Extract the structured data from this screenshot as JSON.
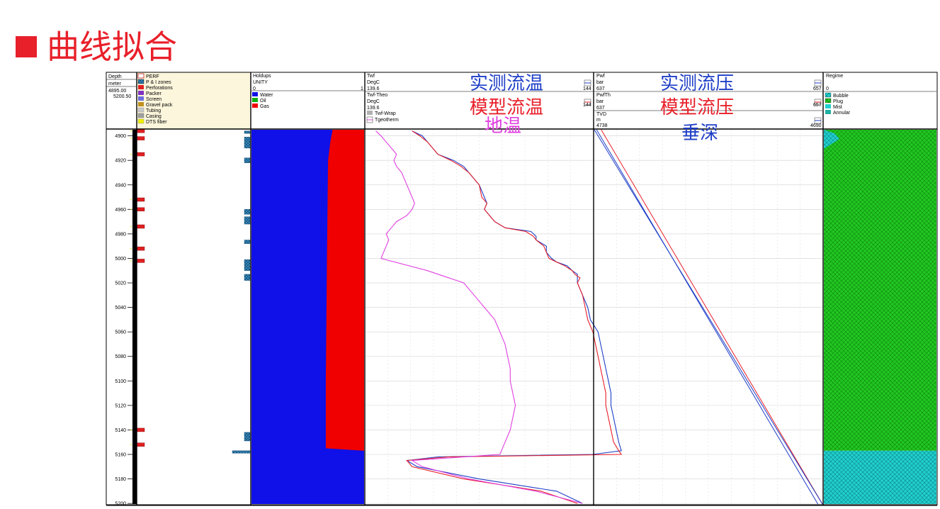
{
  "page": {
    "title": "曲线拟合"
  },
  "overlay": {
    "measured_temp": "实测流温",
    "model_temp": "模型流温",
    "geo_temp": "地温",
    "measured_press": "实测流压",
    "model_press": "模型流压",
    "tvd": "垂深"
  },
  "colors": {
    "title_red": "#e8202a",
    "measured_blue": "#1f3fc7",
    "model_red": "#e8202a",
    "geo_magenta": "#e040e0",
    "water": "#1010e8",
    "gas": "#f00000",
    "regime_green": "#22c822",
    "regime_cyan": "#22d0d0"
  },
  "tracks": {
    "depth": {
      "header": [
        "Depth",
        "meter",
        "4895.00",
        "5200.50"
      ]
    },
    "well": {
      "legend": [
        "PERF",
        "P & I zones",
        "Perforations",
        "Packer",
        "Screen",
        "Gravel pack",
        "Tubing",
        "Casing",
        "DTS fiber"
      ]
    },
    "holdup": {
      "name": "Holdups",
      "unit": "UNITY",
      "min": "0",
      "max": "1",
      "legend": [
        "Water",
        "Oil",
        "Gas"
      ]
    },
    "temp": {
      "h1": [
        "Twf",
        "DegC",
        "139.6",
        "144"
      ],
      "h2": [
        "Twf-Theo",
        "DegC",
        "139.6",
        "144"
      ],
      "h3": [
        "Twf-Wrap",
        "Tgeotherm"
      ]
    },
    "press": {
      "h1": [
        "Pwf",
        "bar",
        "637",
        "657"
      ],
      "h2": [
        "PwfTh",
        "bar",
        "637",
        "657"
      ],
      "h3": [
        "TVD",
        "m",
        "4738",
        "4690"
      ]
    },
    "regime": {
      "name": "Regime",
      "min": "0",
      "legend": [
        "Bubble",
        "Plug",
        "Mist",
        "Annular"
      ]
    }
  },
  "chart_data": {
    "type": "line",
    "depth_axis": {
      "label": "Depth",
      "unit": "meter",
      "range": [
        4895.0,
        5200.5
      ],
      "ticks": [
        4900,
        4920,
        4940,
        4960,
        4980,
        5000,
        5020,
        5040,
        5060,
        5080,
        5100,
        5120,
        5140,
        5160,
        5180,
        5200
      ]
    },
    "temperature": {
      "unit": "DegC",
      "range": [
        139.6,
        144
      ],
      "series": [
        {
          "name": "Twf",
          "depth": [
            4896,
            4900,
            4905,
            4915,
            4920,
            4925,
            4930,
            4940,
            4950,
            4955,
            4960,
            4965,
            4970,
            4975,
            4978,
            4982,
            4985,
            4990,
            4995,
            5000,
            5003,
            5006,
            5010,
            5013,
            5016,
            5020,
            5030,
            5040,
            5050,
            5060,
            5070,
            5080,
            5090,
            5100,
            5110,
            5120,
            5130,
            5140,
            5150,
            5157,
            5160,
            5162,
            5165,
            5170,
            5180,
            5190,
            5200
          ],
          "values": [
            140.5,
            140.7,
            140.8,
            141.0,
            141.3,
            141.5,
            141.6,
            141.8,
            141.9,
            141.95,
            141.9,
            142.0,
            142.1,
            142.3,
            142.8,
            142.9,
            142.9,
            143.1,
            143.1,
            143.2,
            143.3,
            143.5,
            143.6,
            143.7,
            143.7,
            143.7,
            143.8,
            143.9,
            143.95,
            144.1,
            144.15,
            144.2,
            144.25,
            144.3,
            144.35,
            144.35,
            144.4,
            144.45,
            144.5,
            144.55,
            144.0,
            141.0,
            140.4,
            140.6,
            141.8,
            143.3,
            143.8
          ]
        },
        {
          "name": "Twf-Theo",
          "depth": [
            4896,
            4900,
            4905,
            4915,
            4920,
            4925,
            4930,
            4940,
            4950,
            4955,
            4960,
            4965,
            4970,
            4975,
            4978,
            4982,
            4985,
            4990,
            4995,
            5000,
            5003,
            5006,
            5010,
            5013,
            5016,
            5020,
            5030,
            5040,
            5050,
            5060,
            5070,
            5080,
            5090,
            5100,
            5110,
            5120,
            5130,
            5140,
            5150,
            5157,
            5160,
            5162,
            5165,
            5170,
            5180,
            5190,
            5200
          ],
          "values": [
            140.5,
            140.65,
            140.8,
            141.0,
            141.25,
            141.45,
            141.6,
            141.8,
            141.85,
            141.95,
            141.9,
            142.0,
            142.1,
            142.3,
            142.7,
            142.85,
            142.9,
            143.05,
            143.1,
            143.15,
            143.3,
            143.45,
            143.6,
            143.65,
            143.75,
            143.7,
            143.8,
            143.85,
            143.9,
            144.0,
            144.05,
            144.1,
            144.15,
            144.2,
            144.25,
            144.25,
            144.3,
            144.35,
            144.4,
            144.5,
            144.55,
            141.2,
            140.4,
            140.5,
            141.5,
            143.0,
            143.7
          ]
        },
        {
          "name": "Tgeotherm",
          "depth": [
            4896,
            4900,
            4905,
            4910,
            4915,
            4920,
            4925,
            4930,
            4940,
            4950,
            4955,
            4960,
            4965,
            4970,
            4975,
            4980,
            4985,
            4990,
            4995,
            5000,
            5010,
            5020,
            5030,
            5040,
            5050,
            5060,
            5070,
            5080,
            5090,
            5100,
            5110,
            5120,
            5130,
            5140,
            5150,
            5160,
            5165,
            5170,
            5180,
            5190,
            5200
          ],
          "values": [
            139.8,
            139.9,
            140.0,
            140.1,
            140.2,
            140.15,
            140.2,
            140.3,
            140.4,
            140.5,
            140.55,
            140.5,
            140.4,
            140.2,
            140.1,
            140.0,
            140.05,
            140.0,
            139.95,
            139.9,
            140.8,
            141.5,
            141.7,
            141.9,
            142.1,
            142.2,
            142.3,
            142.35,
            142.4,
            142.4,
            142.45,
            142.5,
            142.45,
            142.4,
            142.3,
            142.2,
            140.5,
            140.7,
            141.6,
            142.9,
            143.8
          ]
        }
      ]
    },
    "pressure": {
      "unit": "bar",
      "range": [
        637,
        657
      ],
      "tvd_range": [
        4738,
        4690
      ],
      "series": [
        {
          "name": "Pwf",
          "depth": [
            4895,
            5200.5
          ],
          "values": [
            637.2,
            656.6
          ]
        },
        {
          "name": "PwfTh",
          "depth": [
            4895,
            5200.5
          ],
          "values": [
            637.6,
            657.0
          ]
        },
        {
          "name": "TVD",
          "depth": [
            4895,
            5200.5
          ],
          "values": [
            4738,
            4690
          ]
        }
      ]
    },
    "holdup": {
      "unit": "UNITY",
      "range": [
        0,
        1
      ],
      "water": {
        "depth": [
          4895,
          4905,
          4920,
          5000,
          5100,
          5155,
          5157,
          5200.5
        ],
        "values": [
          0.72,
          0.7,
          0.68,
          0.67,
          0.66,
          0.66,
          1.0,
          1.0
        ]
      }
    },
    "regime": {
      "segments": [
        {
          "from": 4895,
          "to": 5157,
          "type": "Plug"
        },
        {
          "from": 5157,
          "to": 5200.5,
          "type": "Mist"
        }
      ]
    },
    "well_intervals": {
      "perforations": [
        4896,
        4902,
        4915,
        4952,
        4960,
        4974,
        4992,
        5002,
        5140,
        5152
      ],
      "pi_zones": [
        [
          4896,
          4898
        ],
        [
          4901,
          4910
        ],
        [
          4918,
          4922
        ],
        [
          4960,
          4964
        ],
        [
          4966,
          4972
        ],
        [
          4985,
          4988
        ],
        [
          5001,
          5010
        ],
        [
          5013,
          5018
        ],
        [
          5142,
          5149
        ],
        [
          5157,
          5159
        ]
      ]
    }
  }
}
